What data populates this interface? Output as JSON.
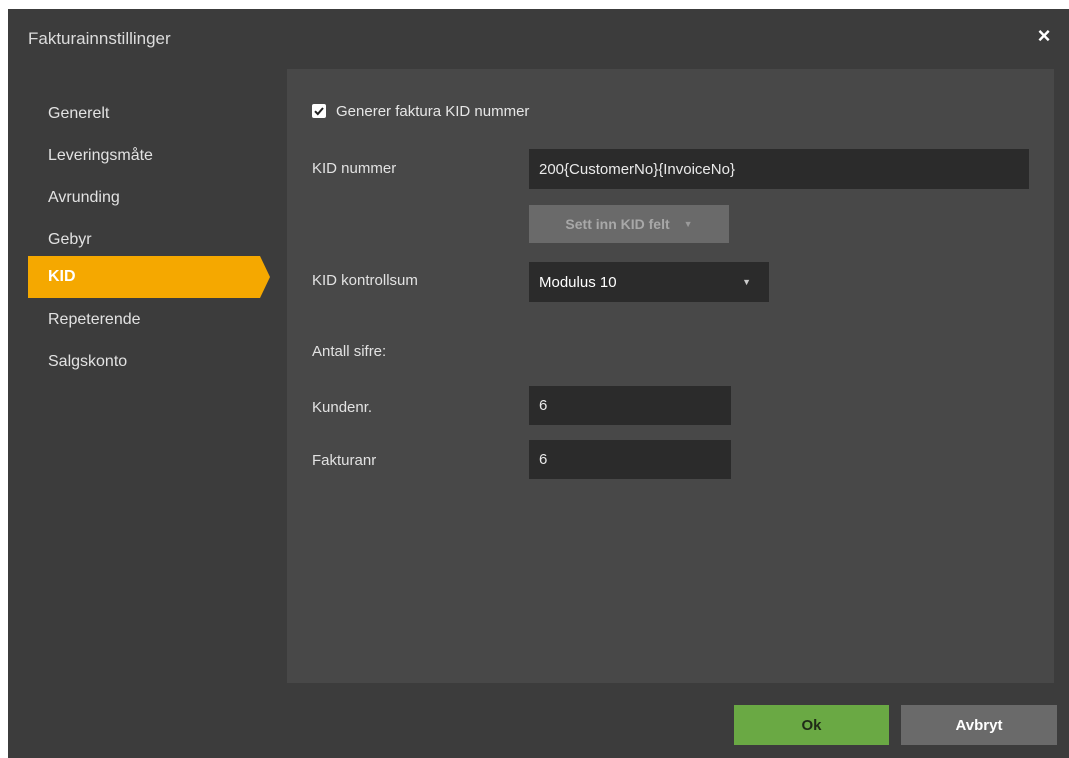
{
  "dialog": {
    "title": "Fakturainnstillinger",
    "close_icon": "close-icon"
  },
  "sidebar": {
    "items": [
      {
        "label": "Generelt",
        "active": false
      },
      {
        "label": "Leveringsmåte",
        "active": false
      },
      {
        "label": "Avrunding",
        "active": false
      },
      {
        "label": "Gebyr",
        "active": false
      },
      {
        "label": "KID",
        "active": true
      },
      {
        "label": "Repeterende",
        "active": false
      },
      {
        "label": "Salgskonto",
        "active": false
      }
    ]
  },
  "kid": {
    "generate_checkbox": {
      "label": "Generer faktura KID nummer",
      "checked": true
    },
    "kid_number_label": "KID nummer",
    "kid_number_value": "200{CustomerNo}{InvoiceNo}",
    "insert_field_button": "Sett inn KID felt",
    "checksum_label": "KID kontrollsum",
    "checksum_value": "Modulus 10",
    "digits_heading": "Antall sifre:",
    "customer_no_label": "Kundenr.",
    "customer_no_value": "6",
    "invoice_no_label": "Fakturanr",
    "invoice_no_value": "6"
  },
  "footer": {
    "ok_label": "Ok",
    "cancel_label": "Avbryt"
  },
  "colors": {
    "active_nav": "#f5a800",
    "ok_button": "#6aa944",
    "dialog_bg": "#3c3c3c",
    "panel_bg": "#484848"
  }
}
